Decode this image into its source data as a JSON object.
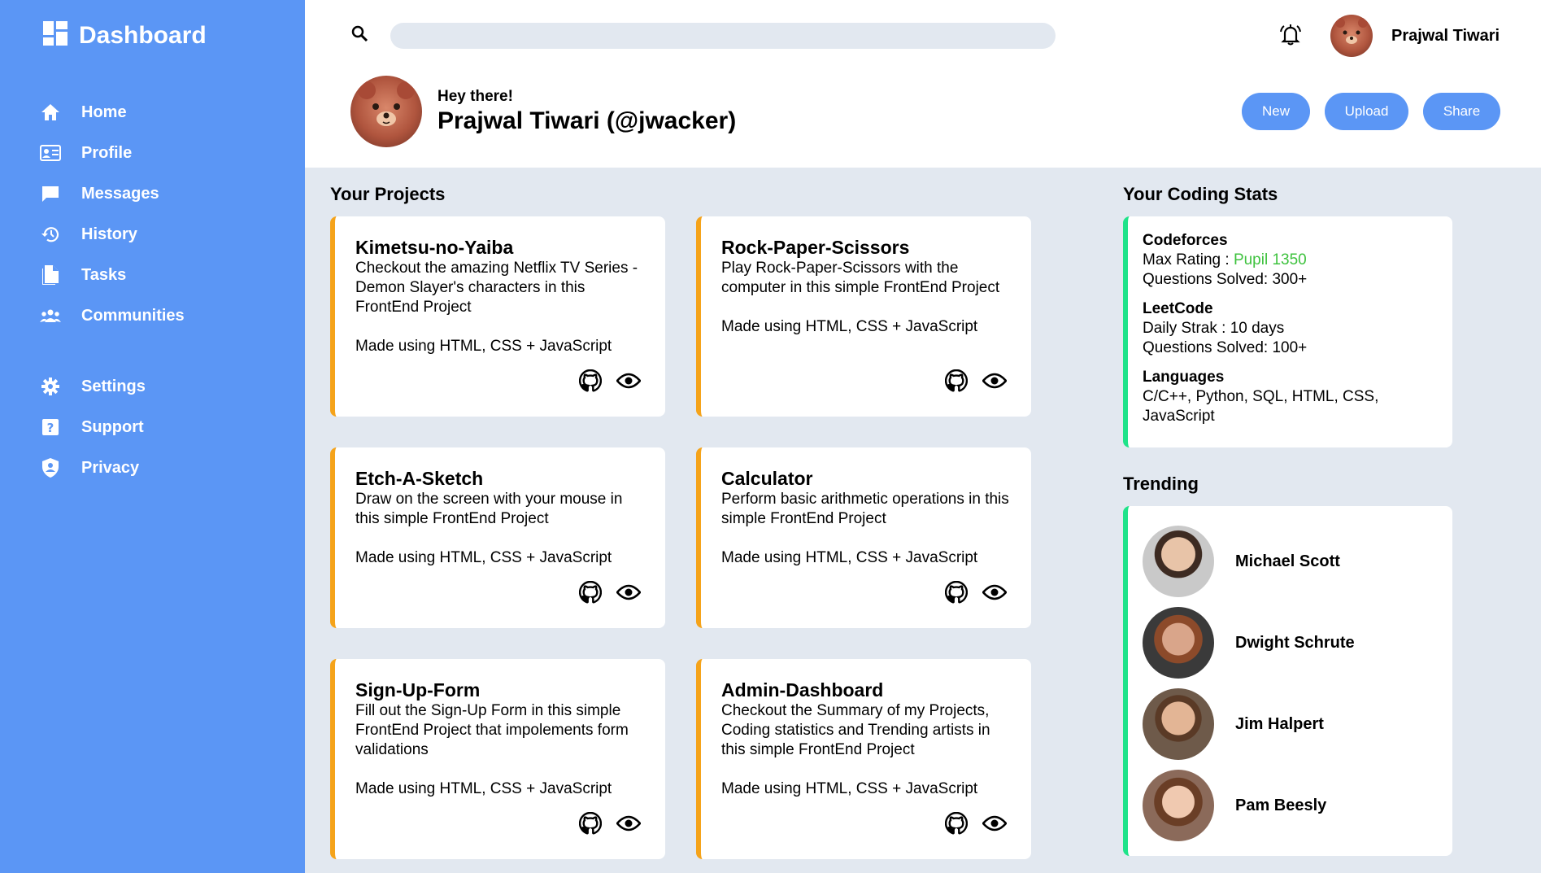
{
  "sidebar": {
    "brand": "Dashboard",
    "nav": [
      {
        "label": "Home",
        "icon": "home-icon"
      },
      {
        "label": "Profile",
        "icon": "id-card-icon"
      },
      {
        "label": "Messages",
        "icon": "message-icon"
      },
      {
        "label": "History",
        "icon": "history-icon"
      },
      {
        "label": "Tasks",
        "icon": "document-icon"
      },
      {
        "label": "Communities",
        "icon": "people-icon"
      }
    ],
    "nav_secondary": [
      {
        "label": "Settings",
        "icon": "gear-icon"
      },
      {
        "label": "Support",
        "icon": "help-icon"
      },
      {
        "label": "Privacy",
        "icon": "shield-icon"
      }
    ]
  },
  "header": {
    "search_placeholder": "",
    "username": "Prajwal Tiwari",
    "greeting": "Hey there!",
    "full_name": "Prajwal Tiwari (@jwacker)",
    "buttons": {
      "new": "New",
      "upload": "Upload",
      "share": "Share"
    }
  },
  "projects": {
    "title": "Your Projects",
    "items": [
      {
        "title": "Kimetsu-no-Yaiba",
        "desc": "Checkout the amazing Netflix TV Series - Demon Slayer's characters in this FrontEnd Project",
        "tech": "Made using HTML, CSS + JavaScript"
      },
      {
        "title": "Rock-Paper-Scissors",
        "desc": "Play Rock-Paper-Scissors with the computer in this simple FrontEnd Project",
        "tech": "Made using HTML, CSS + JavaScript"
      },
      {
        "title": "Etch-A-Sketch",
        "desc": "Draw on the screen with your mouse in this simple FrontEnd Project",
        "tech": "Made using HTML, CSS + JavaScript"
      },
      {
        "title": "Calculator",
        "desc": "Perform basic arithmetic operations in this simple FrontEnd Project",
        "tech": "Made using HTML, CSS + JavaScript"
      },
      {
        "title": "Sign-Up-Form",
        "desc": "Fill out the Sign-Up Form in this simple FrontEnd Project that impolements form validations",
        "tech": "Made using HTML, CSS + JavaScript"
      },
      {
        "title": "Admin-Dashboard",
        "desc": "Checkout the Summary of my Projects, Coding statistics and Trending artists in this simple FrontEnd Project",
        "tech": "Made using HTML, CSS + JavaScript"
      }
    ]
  },
  "stats": {
    "title": "Your Coding Stats",
    "codeforces": {
      "head": "Codeforces",
      "rating_label": "Max Rating : ",
      "rating_value": "Pupil 1350",
      "solved": "Questions Solved: 300+"
    },
    "leetcode": {
      "head": "LeetCode",
      "streak": "Daily Strak : 10 days",
      "solved": "Questions Solved: 100+"
    },
    "languages": {
      "head": "Languages",
      "list": "C/C++, Python, SQL, HTML, CSS, JavaScript"
    },
    "rating_color": "#3ec23e"
  },
  "trending": {
    "title": "Trending",
    "people": [
      {
        "name": "Michael Scott"
      },
      {
        "name": "Dwight Schrute"
      },
      {
        "name": "Jim Halpert"
      },
      {
        "name": "Pam Beesly"
      }
    ]
  },
  "colors": {
    "accent": "#5b96f5",
    "project_border": "#f5a31a",
    "stats_border": "#1fe38a",
    "background": "#e2e8f0"
  }
}
